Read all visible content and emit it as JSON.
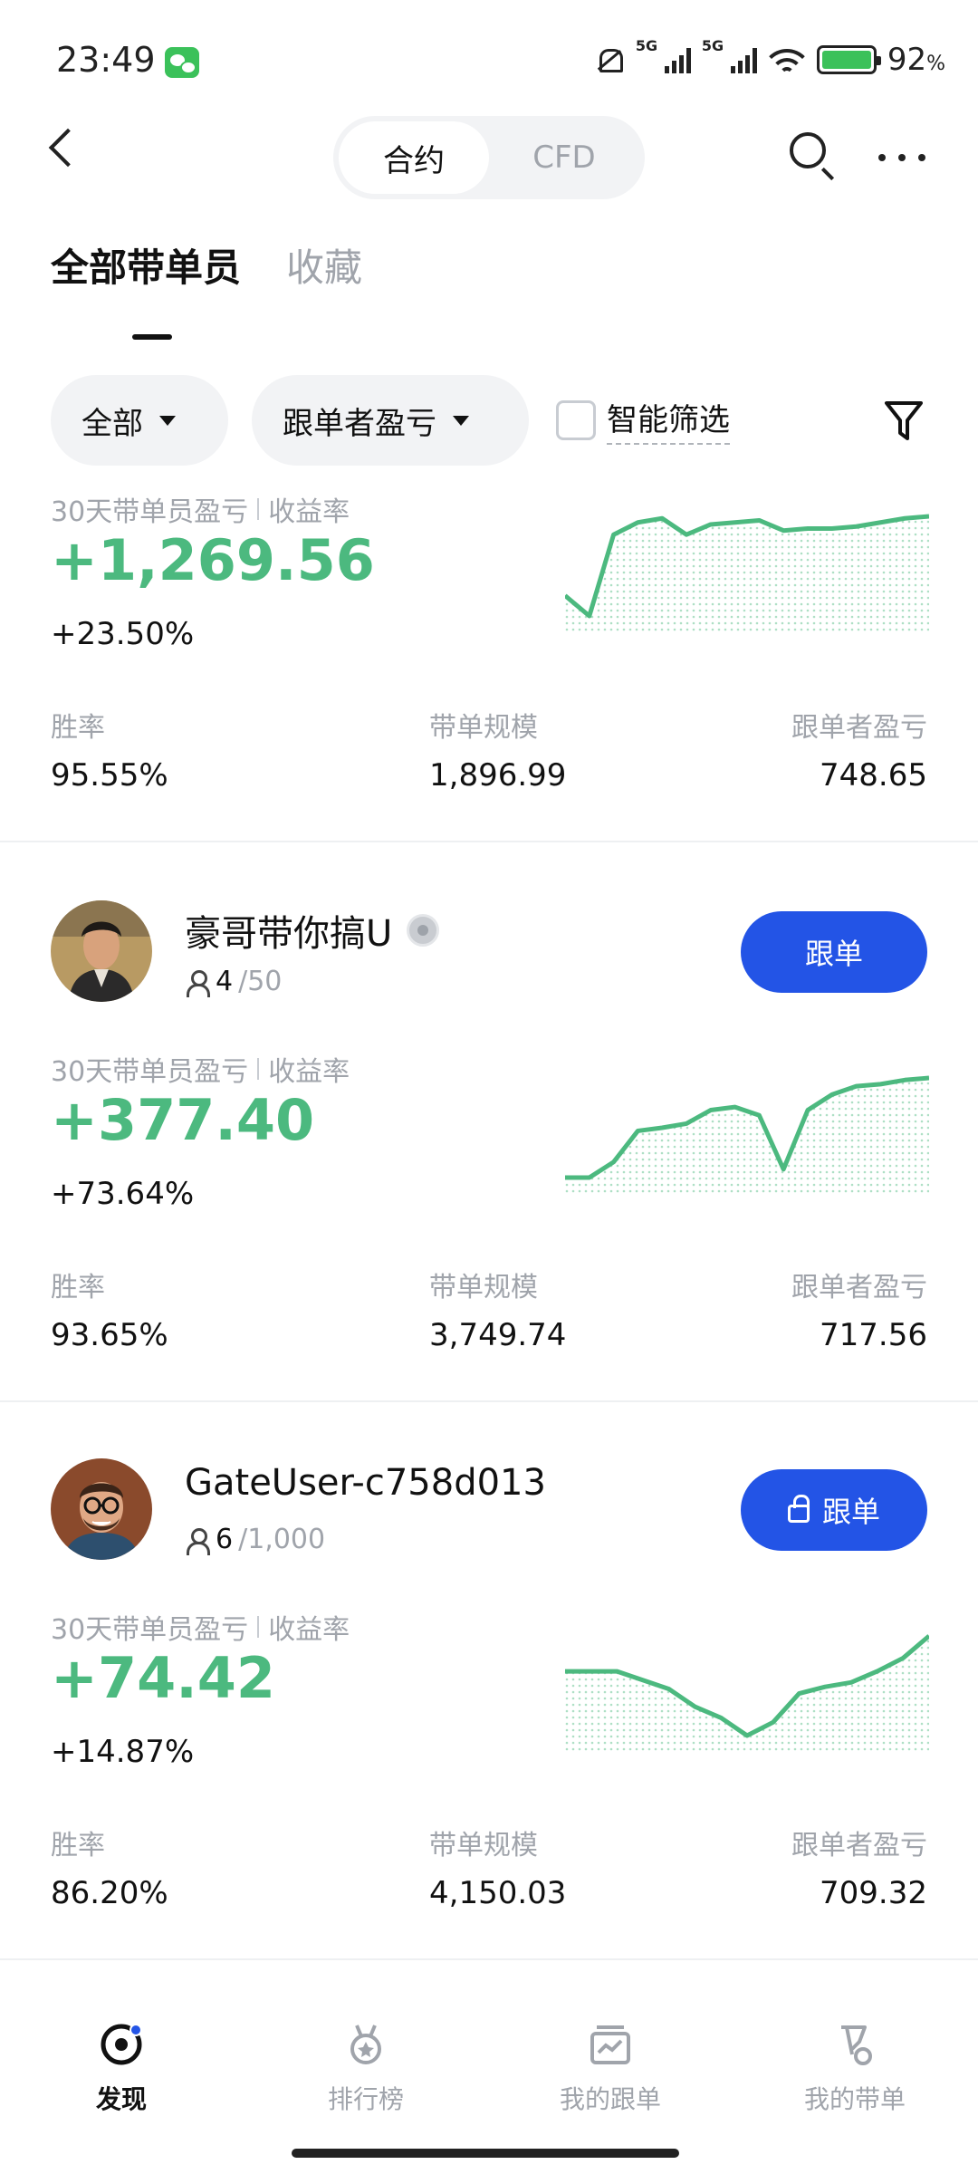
{
  "status_bar": {
    "time": "23:49",
    "network1": "5G",
    "network2": "5G",
    "battery_pct": "92",
    "battery_unit": "%"
  },
  "header": {
    "segments": [
      {
        "label": "合约",
        "active": true
      },
      {
        "label": "CFD",
        "active": false
      }
    ]
  },
  "tabs": [
    {
      "label": "全部带单员",
      "active": true
    },
    {
      "label": "收藏",
      "active": false
    }
  ],
  "filters": {
    "scope": "全部",
    "sort": "跟单者盈亏",
    "smart_filter": "智能筛选",
    "smart_filter_checked": false
  },
  "labels": {
    "pnl": "30天带单员盈亏",
    "roi": "收益率",
    "win_rate": "胜率",
    "scale": "带单规模",
    "follower_pnl": "跟单者盈亏"
  },
  "colors": {
    "profit": "#4cb97f",
    "primary_button": "#2354e6"
  },
  "traders": [
    {
      "name": "",
      "followers": "",
      "follower_max": "",
      "pnl": "+1,269.56",
      "roi": "+23.50%",
      "win_rate": "95.55%",
      "scale": "1,896.99",
      "follower_pnl": "748.65",
      "spark": [
        2,
        0,
        8,
        9.2,
        9.6,
        8,
        9,
        9.2,
        9.4,
        8.4,
        8.6,
        8.6,
        8.8,
        9.2,
        9.6,
        9.8
      ]
    },
    {
      "name": "豪哥带你搞U",
      "followers": "4",
      "follower_max": "/50",
      "button": "跟单",
      "locked": false,
      "pnl": "+377.40",
      "roi": "+73.64%",
      "win_rate": "93.65%",
      "scale": "3,749.74",
      "follower_pnl": "717.56",
      "spark": [
        0,
        0,
        1.5,
        4.5,
        4.8,
        5.2,
        6.5,
        6.8,
        6,
        0.8,
        6.5,
        8,
        8.8,
        9,
        9.4,
        9.6
      ]
    },
    {
      "name": "GateUser-c758d013",
      "followers": "6",
      "follower_max": "/1,000",
      "button": "跟单",
      "locked": true,
      "pnl": "+74.42",
      "roi": "+14.87%",
      "win_rate": "86.20%",
      "scale": "4,150.03",
      "follower_pnl": "709.32",
      "spark": [
        6.8,
        6.8,
        6.8,
        6,
        5.2,
        3.6,
        2.6,
        1,
        2.2,
        4.8,
        5.4,
        5.8,
        6.8,
        8,
        10
      ]
    }
  ],
  "bottom_nav": [
    {
      "label": "发现",
      "icon": "discover-icon",
      "active": true
    },
    {
      "label": "排行榜",
      "icon": "medal-icon",
      "active": false
    },
    {
      "label": "我的跟单",
      "icon": "chart-folder-icon",
      "active": false
    },
    {
      "label": "我的带单",
      "icon": "flag-icon",
      "active": false
    }
  ]
}
